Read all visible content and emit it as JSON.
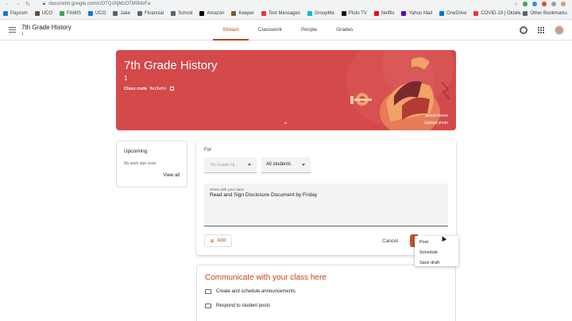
{
  "browser": {
    "url": "classroom.google.com/c/OTQ1NjMzOTM0MzFa",
    "bookmarks": [
      "Paycom",
      "UCO",
      "FAMIS",
      "UCO",
      "Jake",
      "Financial",
      "School",
      "Amazon",
      "Keeper",
      "Text Messages",
      "GroupMe",
      "Pluto TV",
      "Netflix",
      "Yahoo Mail",
      "OneDrive",
      "COVID-19 | Oklah..."
    ],
    "other_bookmarks": "Other Bookmarks",
    "bookmark_colors": [
      "#1a73e8",
      "#6d4c41",
      "#34a853",
      "#1a73e8",
      "#5f6368",
      "#5f6368",
      "#5f6368",
      "#000000",
      "#7b5e2a",
      "#e53935",
      "#00bcd4",
      "#111111",
      "#e50914",
      "#6001d2",
      "#0078d4",
      "#e53935"
    ]
  },
  "header": {
    "class_title": "7th Grade History",
    "class_subtitle": "1",
    "tabs": [
      "Stream",
      "Classwork",
      "People",
      "Grades"
    ],
    "active_tab": "Stream"
  },
  "banner": {
    "title": "7th Grade History",
    "section": "1",
    "class_code_label": "Class code",
    "class_code": "fbn3whn",
    "select_theme": "Select theme",
    "upload_photo": "Upload photo",
    "color": "#d4494a"
  },
  "upcoming": {
    "heading": "Upcoming",
    "message": "No work due soon",
    "view_all": "View all"
  },
  "composer": {
    "for_label": "For",
    "class_select": "7th Grade Hi...",
    "students_select": "All students",
    "placeholder": "Share with your class",
    "value": "Read and Sign Disclosure Document by Friday",
    "add_label": "Add",
    "cancel_label": "Cancel"
  },
  "post_menu": [
    "Post",
    "Schedule",
    "Save draft"
  ],
  "communicate": {
    "heading": "Communicate with your class here",
    "items": [
      "Create and schedule announcements",
      "Respond to student posts"
    ]
  },
  "accent_color": "#c5421f"
}
